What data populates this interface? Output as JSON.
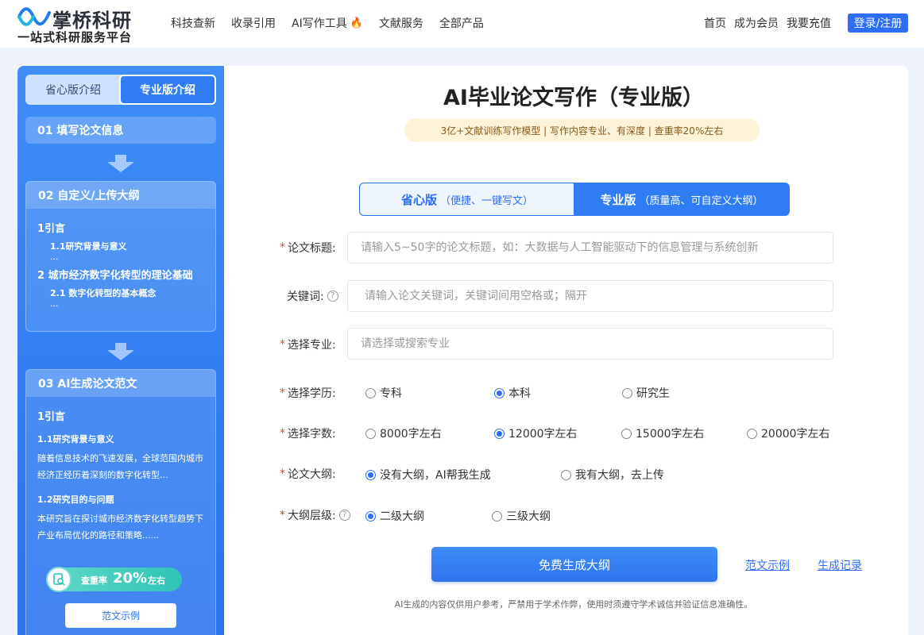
{
  "header": {
    "logo_title": "掌桥科研",
    "logo_sub": "一站式科研服务平台",
    "nav": [
      "科技查新",
      "收录引用",
      "AI写作工具",
      "文献服务",
      "全部产品"
    ],
    "nav_right": [
      "首页",
      "成为会员",
      "我要充值"
    ],
    "login": "登录/注册"
  },
  "left": {
    "tab_a": "省心版介绍",
    "tab_b": "专业版介绍",
    "step1": "01  填写论文信息",
    "step2": "02  自定义/上传大纲",
    "outline": {
      "l1a": "1引言",
      "l2a": "1.1研究背景与意义",
      "dots": "...",
      "l1b": "2 城市经济数字化转型的理论基础",
      "l2b": "2.1 数字化转型的基本概念"
    },
    "step3": "03  AI生成论文范文",
    "essay": {
      "h1": "1引言",
      "h2a": "1.1研究背景与意义",
      "p1": "随着信息技术的飞速发展，全球范围内城市经济正经历着深刻的数字化转型...",
      "h2b": "1.2研究目的与问题",
      "p2": "本研究旨在探讨城市经济数字化转型趋势下产业布局优化的路径和策略......"
    },
    "badge": {
      "t1": "查重率",
      "t2": "20%",
      "t3": "左右"
    },
    "sample_btn": "范文示例"
  },
  "main": {
    "title": "AI毕业论文写作（专业版）",
    "subtitle": "3亿+文献训练写作模型 | 写作内容专业、有深度 | 查重率20%左右",
    "mode_a_main": "省心版",
    "mode_a_sub": "（便捷、一键写文）",
    "mode_b_main": "专业版",
    "mode_b_sub": "（质量高、可自定义大纲）",
    "fields": {
      "title_label": "论文标题:",
      "title_placeholder": "请输入5~50字的论文标题，如：大数据与人工智能驱动下的信息管理与系统创新",
      "keywords_label": "关键词:",
      "keywords_placeholder": "请输入论文关键词，关键词间用空格或；隔开",
      "major_label": "选择专业:",
      "major_placeholder": "请选择或搜索专业",
      "degree_label": "选择学历:",
      "degree_options": [
        "专科",
        "本科",
        "研究生"
      ],
      "words_label": "选择字数:",
      "words_options": [
        "8000字左右",
        "12000字左右",
        "15000字左右",
        "20000字左右"
      ],
      "outline_label": "论文大纲:",
      "outline_options": [
        "没有大纲，AI帮我生成",
        "我有大纲，去上传"
      ],
      "level_label": "大纲层级:",
      "level_options": [
        "二级大纲",
        "三级大纲"
      ]
    },
    "gen_btn": "免费生成大纲",
    "link_sample": "范文示例",
    "link_records": "生成记录",
    "disclaimer": "AI生成的内容仅供用户参考，严禁用于学术作弊，使用时须遵守学术诚信并验证信息准确性。"
  },
  "colors": {
    "accent": "#2e6ef5",
    "required": "#e23b3b",
    "badge": "#2fc4b6"
  }
}
